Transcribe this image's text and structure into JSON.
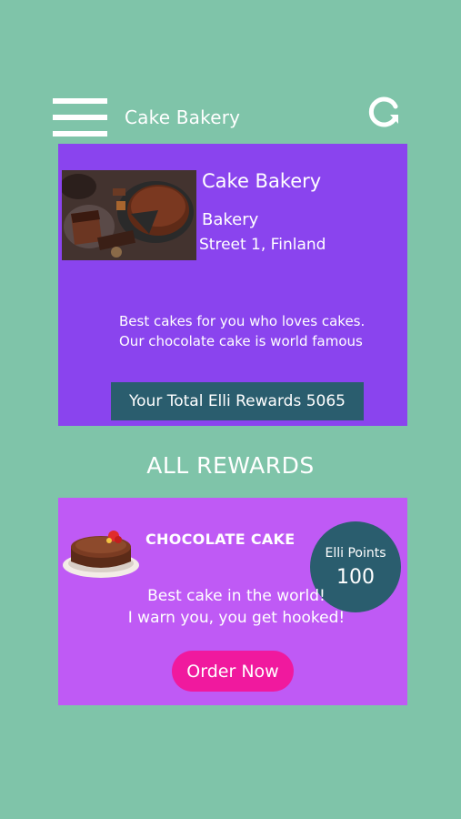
{
  "header": {
    "menu_icon": "hamburger-menu-icon",
    "title": "Cake Bakery",
    "refresh_icon": "refresh-icon"
  },
  "bakery": {
    "name": "Cake Bakery",
    "type": "Bakery",
    "address": "Street 1, Finland",
    "description": "Best cakes for you who loves cakes. Our chocolate cake is world famous",
    "rewards_total": "Your Total Elli Rewards 5065"
  },
  "rewards_heading": "ALL REWARDS",
  "reward": {
    "title": "CHOCOLATE CAKE",
    "points_label": "Elli Points",
    "points_value": "100",
    "description_line1": "Best cake in the world!",
    "description_line2": "I warn you, you get hooked!",
    "order_label": "Order Now"
  },
  "colors": {
    "background": "#7fc4a9",
    "bakery_card": "#8a44ee",
    "reward_card": "#bf5af5",
    "accent_dark": "#2a5d6e",
    "order_button": "#f0199e"
  }
}
